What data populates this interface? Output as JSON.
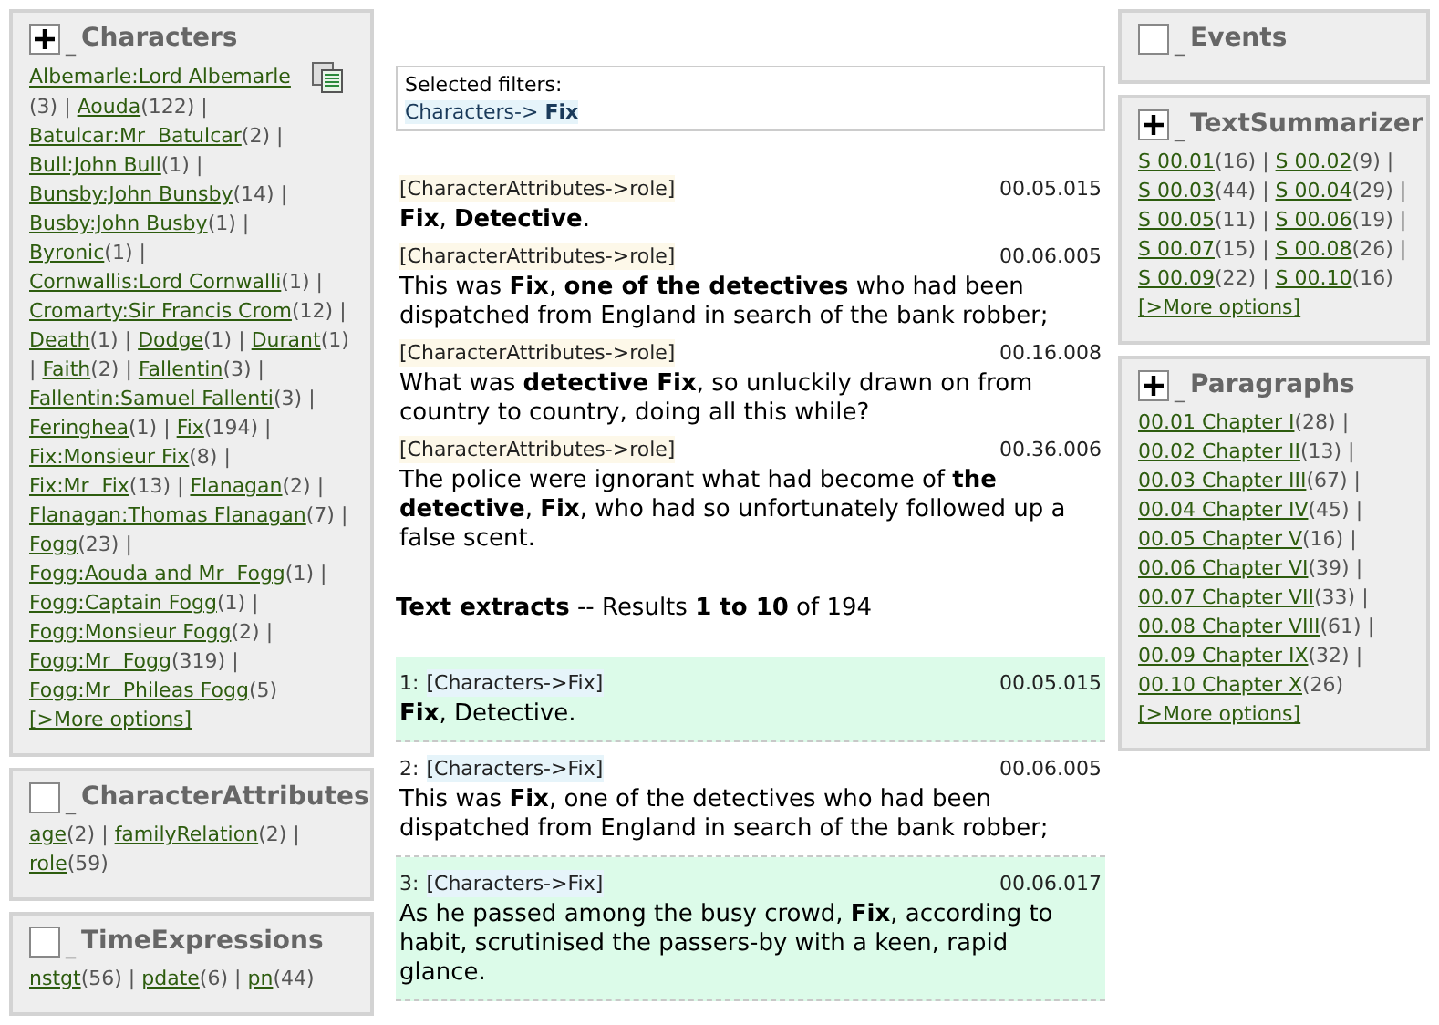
{
  "left_facets": [
    {
      "title": "Characters",
      "marker": "_",
      "expanded": true,
      "separator": "|",
      "copy_icon": true,
      "items": [
        {
          "label": "Albemarle:Lord Albemarle",
          "count": "(3)"
        },
        {
          "label": "Aouda",
          "count": "(122)"
        },
        {
          "label": "Batulcar:Mr  Batulcar",
          "count": "(2)"
        },
        {
          "label": "Bull:John Bull",
          "count": "(1)"
        },
        {
          "label": "Bunsby:John Bunsby",
          "count": "(14)"
        },
        {
          "label": "Busby:John Busby",
          "count": "(1)"
        },
        {
          "label": "Byronic",
          "count": "(1)"
        },
        {
          "label": "Cornwallis:Lord Cornwalli",
          "count": "(1)"
        },
        {
          "label": "Cromarty:Sir Francis Crom",
          "count": "(12)"
        },
        {
          "label": "Death",
          "count": "(1)"
        },
        {
          "label": "Dodge",
          "count": "(1)"
        },
        {
          "label": "Durant",
          "count": "(1)"
        },
        {
          "label": "Faith",
          "count": "(2)"
        },
        {
          "label": "Fallentin",
          "count": "(3)"
        },
        {
          "label": "Fallentin:Samuel Fallenti",
          "count": "(3)"
        },
        {
          "label": "Feringhea",
          "count": "(1)"
        },
        {
          "label": "Fix",
          "count": "(194)"
        },
        {
          "label": "Fix:Monsieur Fix",
          "count": "(8)"
        },
        {
          "label": "Fix:Mr  Fix",
          "count": "(13)"
        },
        {
          "label": "Flanagan",
          "count": "(2)"
        },
        {
          "label": "Flanagan:Thomas Flanagan",
          "count": "(7)"
        },
        {
          "label": "Fogg",
          "count": "(23)"
        },
        {
          "label": "Fogg:Aouda and Mr  Fogg",
          "count": "(1)"
        },
        {
          "label": "Fogg:Captain Fogg",
          "count": "(1)"
        },
        {
          "label": "Fogg:Monsieur Fogg",
          "count": "(2)"
        },
        {
          "label": "Fogg:Mr  Fogg",
          "count": "(319)"
        },
        {
          "label": "Fogg:Mr  Phileas Fogg",
          "count": "(5)"
        }
      ],
      "more": "[>More options]"
    },
    {
      "title": "CharacterAttributes",
      "marker": "_",
      "expanded": false,
      "separator": "|",
      "items": [
        {
          "label": "age",
          "count": "(2)"
        },
        {
          "label": "familyRelation",
          "count": "(2)"
        },
        {
          "label": "role",
          "count": "(59)"
        }
      ]
    },
    {
      "title": "TimeExpressions",
      "marker": "_",
      "expanded": false,
      "separator": "|",
      "items": [
        {
          "label": "nstgt",
          "count": "(56)"
        },
        {
          "label": "pdate",
          "count": "(6)"
        },
        {
          "label": "pn",
          "count": "(44)"
        }
      ]
    }
  ],
  "selected_filters": {
    "label": "Selected filters:",
    "filter": "Characters-> **Fix**"
  },
  "role_results": [
    {
      "tag": "[CharacterAttributes->role]",
      "time": "00.05.015",
      "text": "**Fix**, **Detective**."
    },
    {
      "tag": "[CharacterAttributes->role]",
      "time": "00.06.005",
      "text": "This was **Fix**, **one of the detectives** who had been dispatched from England in search of the bank robber;"
    },
    {
      "tag": "[CharacterAttributes->role]",
      "time": "00.16.008",
      "text": "What was **detective Fix**, so unluckily drawn on from country to country, doing all this while?"
    },
    {
      "tag": "[CharacterAttributes->role]",
      "time": "00.36.006",
      "text": "The police were ignorant what had become of **the detective**, **Fix**, who had so unfortunately followed up a false scent."
    }
  ],
  "extracts_header": "**Text extracts** -- Results **1 to 10** of 194",
  "extracts": [
    {
      "index": "1:",
      "tag": "[Characters->Fix]",
      "time": "00.05.015",
      "text": "**Fix**, Detective.",
      "highlighted": true
    },
    {
      "index": "2:",
      "tag": "[Characters->Fix]",
      "time": "00.06.005",
      "text": "This was **Fix**, one of the detectives who had been dispatched from England in search of the bank robber;",
      "highlighted": false
    },
    {
      "index": "3:",
      "tag": "[Characters->Fix]",
      "time": "00.06.017",
      "text": "As he passed among the busy crowd, **Fix**, according to habit, scrutinised the passers-by with a keen, rapid glance.",
      "highlighted": true
    }
  ],
  "right_facets": [
    {
      "title": "Events",
      "marker": "_",
      "expanded": false
    },
    {
      "title": "TextSummarizer",
      "marker": "_",
      "expanded": true,
      "separator": "|",
      "items": [
        {
          "label": "S 00.01",
          "count": "(16)"
        },
        {
          "label": "S 00.02",
          "count": "(9)"
        },
        {
          "label": "S 00.03",
          "count": "(44)"
        },
        {
          "label": "S 00.04",
          "count": "(29)"
        },
        {
          "label": "S 00.05",
          "count": "(11)"
        },
        {
          "label": "S 00.06",
          "count": "(19)"
        },
        {
          "label": "S 00.07",
          "count": "(15)"
        },
        {
          "label": "S 00.08",
          "count": "(26)"
        },
        {
          "label": "S 00.09",
          "count": "(22)"
        },
        {
          "label": "S 00.10",
          "count": "(16)"
        }
      ],
      "more": "[>More options]"
    },
    {
      "title": "Paragraphs",
      "marker": "_",
      "expanded": true,
      "separator": "|",
      "items": [
        {
          "label": "00.01 Chapter I",
          "count": "(28)"
        },
        {
          "label": "00.02 Chapter II",
          "count": "(13)"
        },
        {
          "label": "00.03 Chapter III",
          "count": "(67)"
        },
        {
          "label": "00.04 Chapter IV",
          "count": "(45)"
        },
        {
          "label": "00.05 Chapter V",
          "count": "(16)"
        },
        {
          "label": "00.06 Chapter VI",
          "count": "(39)"
        },
        {
          "label": "00.07 Chapter VII",
          "count": "(33)"
        },
        {
          "label": "00.08 Chapter VIII",
          "count": "(61)"
        },
        {
          "label": "00.09 Chapter IX",
          "count": "(32)"
        },
        {
          "label": "00.10 Chapter X",
          "count": "(26)"
        }
      ],
      "more": "[>More options]"
    }
  ]
}
